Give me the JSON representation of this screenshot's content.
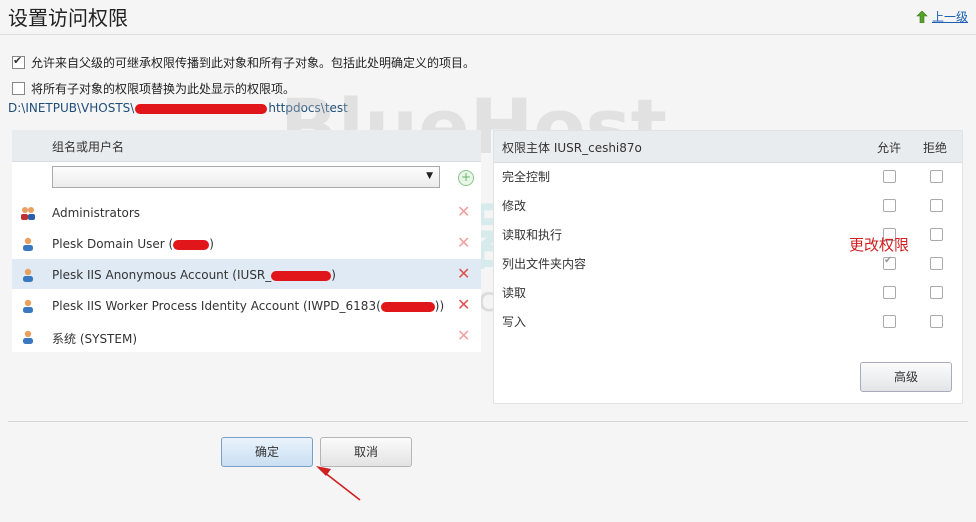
{
  "page": {
    "title": "设置访问权限",
    "up_level": "上一级",
    "checkbox_inherit": "允许来自父级的可继承权限传播到此对象和所有子对象。包括此处明确定义的项目。",
    "checkbox_replace": "将所有子对象的权限项替换为此处显示的权限项。",
    "path_prefix": "D:\\INETPUB\\VHOSTS\\",
    "path_suffix": "httpdocs\\test"
  },
  "users": {
    "header": "组名或用户名",
    "rows": [
      {
        "name": "Administrators",
        "icon": "group-icon"
      },
      {
        "name": "Plesk Domain User (",
        "suffix": ")",
        "icon": "user-icon"
      },
      {
        "name": "Plesk IIS Anonymous Account (IUSR_",
        "suffix": ")",
        "icon": "user-icon"
      },
      {
        "name": "Plesk IIS Worker Process Identity Account (IWPD_6183(",
        "suffix": "))",
        "icon": "user-icon"
      },
      {
        "name": "系统 (SYSTEM)",
        "icon": "user-icon"
      }
    ]
  },
  "permissions": {
    "header": "权限主体 IUSR_ceshi87o",
    "allow": "允许",
    "deny": "拒绝",
    "rows": [
      {
        "label": "完全控制",
        "allow": false,
        "deny": false
      },
      {
        "label": "修改",
        "allow": false,
        "deny": false
      },
      {
        "label": "读取和执行",
        "allow": false,
        "deny": false
      },
      {
        "label": "列出文件夹内容",
        "allow": true,
        "deny": false
      },
      {
        "label": "读取",
        "allow": false,
        "deny": false
      },
      {
        "label": "写入",
        "allow": false,
        "deny": false
      }
    ],
    "advanced": "高级"
  },
  "annotation": "更改权限",
  "buttons": {
    "ok": "确定",
    "cancel": "取消"
  },
  "watermark": {
    "line1": "BlueHost",
    "line2": "香港服务器评测",
    "line3": "https://idcspy.com/"
  },
  "colors": {
    "annotation_red": "#d02020",
    "link_blue": "#1a5fb4"
  }
}
